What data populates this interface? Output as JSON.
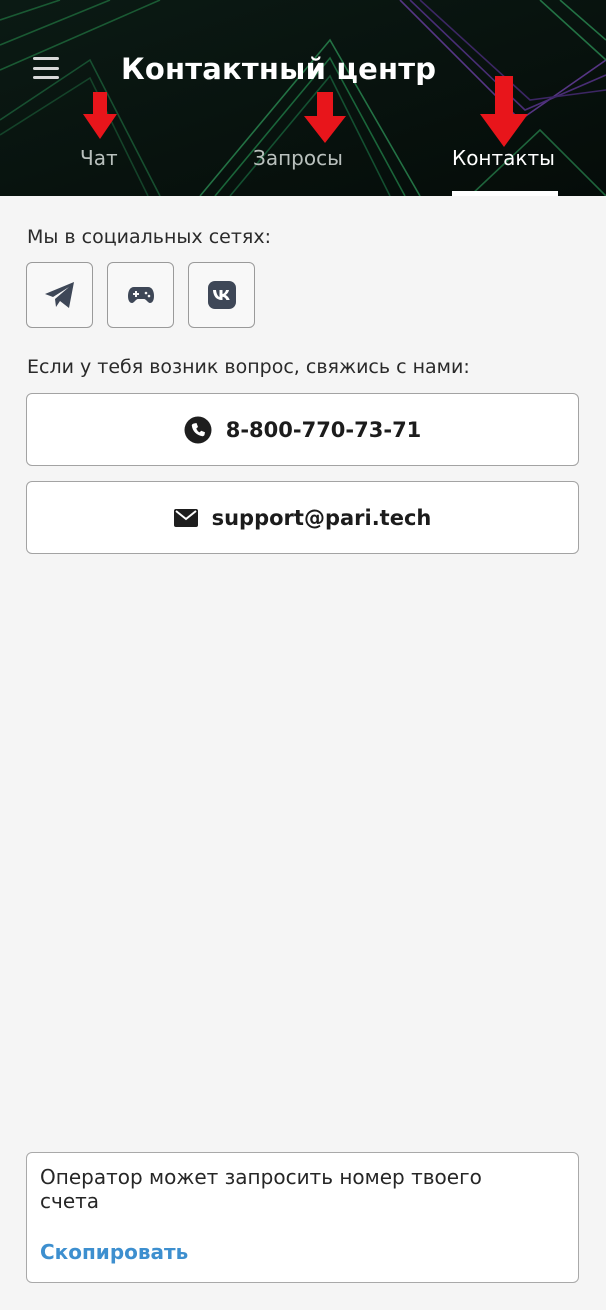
{
  "header": {
    "title": "Контактный центр",
    "tabs": [
      {
        "label": "Чат",
        "active": false
      },
      {
        "label": "Запросы",
        "active": false
      },
      {
        "label": "Контакты",
        "active": true
      }
    ]
  },
  "social": {
    "label": "Мы в социальных сетях:",
    "items": [
      {
        "icon": "telegram-icon"
      },
      {
        "icon": "gamepad-icon"
      },
      {
        "icon": "vk-icon"
      }
    ]
  },
  "contacts": {
    "label": "Если у тебя возник вопрос, свяжись с нами:",
    "phone": "8-800-770-73-71",
    "email": "support@pari.tech"
  },
  "notice": {
    "text": "Оператор может запросить номер твоего счета",
    "copy_label": "Скопировать"
  },
  "colors": {
    "header_bg": "#07130f",
    "accent_link": "#3d8fcf",
    "annotation_arrow": "#e8151b"
  }
}
